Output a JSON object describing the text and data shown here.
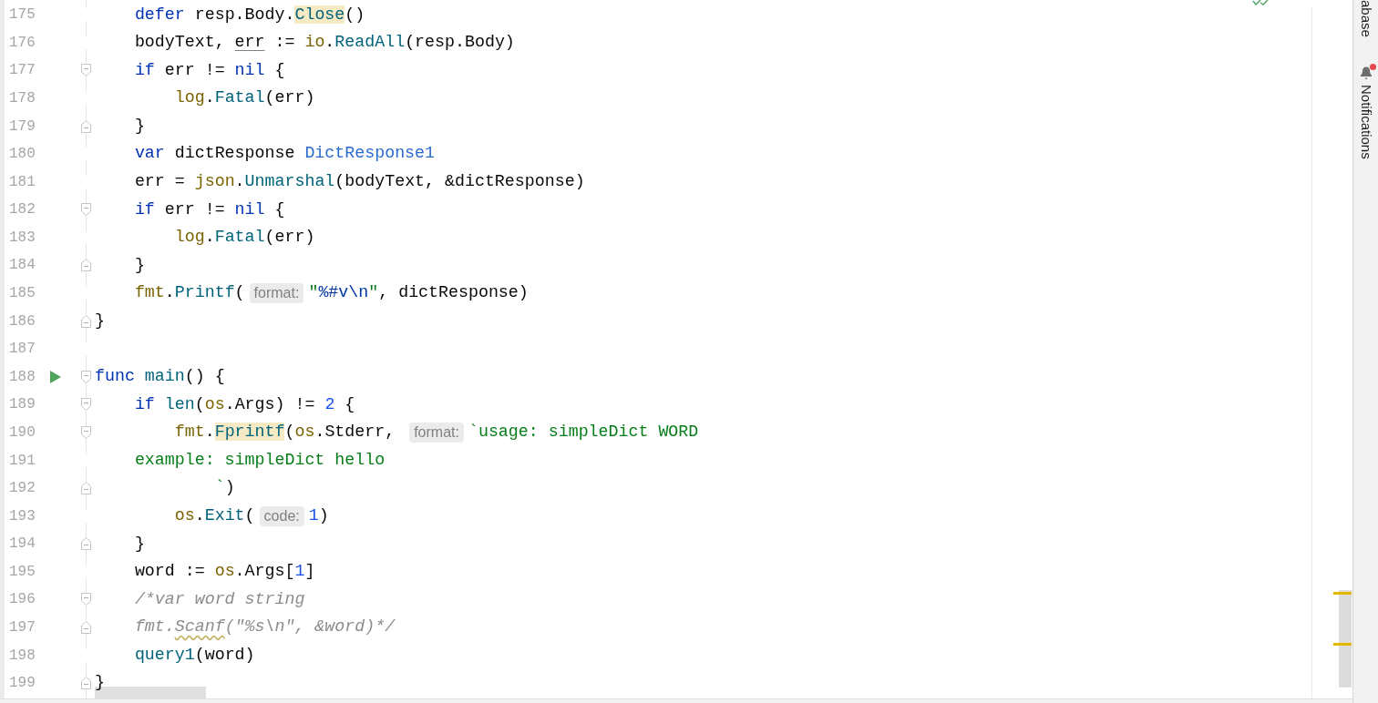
{
  "editor": {
    "lines": [
      {
        "number": "175",
        "tokens": [
          {
            "kind": "keyword",
            "text": "    defer"
          },
          {
            "kind": "plain",
            "text": " resp.Body."
          },
          {
            "kind": "function",
            "text": "Close",
            "highlighted": true
          },
          {
            "kind": "plain",
            "text": "()"
          }
        ]
      },
      {
        "number": "176",
        "tokens": [
          {
            "kind": "plain",
            "text": "    bodyText, "
          },
          {
            "kind": "plain",
            "text": "err",
            "underlined": true
          },
          {
            "kind": "plain",
            "text": " := "
          },
          {
            "kind": "package",
            "text": "io"
          },
          {
            "kind": "plain",
            "text": "."
          },
          {
            "kind": "function",
            "text": "ReadAll"
          },
          {
            "kind": "plain",
            "text": "(resp.Body)"
          }
        ]
      },
      {
        "number": "177",
        "fold_start": true,
        "tokens": [
          {
            "kind": "keyword",
            "text": "    if"
          },
          {
            "kind": "plain",
            "text": " err != "
          },
          {
            "kind": "keyword",
            "text": "nil"
          },
          {
            "kind": "plain",
            "text": " {"
          }
        ]
      },
      {
        "number": "178",
        "tokens": [
          {
            "kind": "package",
            "text": "        log"
          },
          {
            "kind": "plain",
            "text": "."
          },
          {
            "kind": "function",
            "text": "Fatal"
          },
          {
            "kind": "plain",
            "text": "(err)"
          }
        ]
      },
      {
        "number": "179",
        "fold_end": true,
        "tokens": [
          {
            "kind": "plain",
            "text": "    }"
          }
        ]
      },
      {
        "number": "180",
        "tokens": [
          {
            "kind": "keyword",
            "text": "    var"
          },
          {
            "kind": "plain",
            "text": " dictResponse "
          },
          {
            "kind": "type",
            "text": "DictResponse1"
          }
        ]
      },
      {
        "number": "181",
        "tokens": [
          {
            "kind": "plain",
            "text": "    err = "
          },
          {
            "kind": "package",
            "text": "json"
          },
          {
            "kind": "plain",
            "text": "."
          },
          {
            "kind": "function",
            "text": "Unmarshal"
          },
          {
            "kind": "plain",
            "text": "(bodyText, &dictResponse)"
          }
        ]
      },
      {
        "number": "182",
        "fold_start": true,
        "tokens": [
          {
            "kind": "keyword",
            "text": "    if"
          },
          {
            "kind": "plain",
            "text": " err != "
          },
          {
            "kind": "keyword",
            "text": "nil"
          },
          {
            "kind": "plain",
            "text": " {"
          }
        ]
      },
      {
        "number": "183",
        "tokens": [
          {
            "kind": "package",
            "text": "        log"
          },
          {
            "kind": "plain",
            "text": "."
          },
          {
            "kind": "function",
            "text": "Fatal"
          },
          {
            "kind": "plain",
            "text": "(err)"
          }
        ]
      },
      {
        "number": "184",
        "fold_end": true,
        "tokens": [
          {
            "kind": "plain",
            "text": "    }"
          }
        ]
      },
      {
        "number": "185",
        "tokens": [
          {
            "kind": "package",
            "text": "    fmt"
          },
          {
            "kind": "plain",
            "text": "."
          },
          {
            "kind": "function",
            "text": "Printf"
          },
          {
            "kind": "plain",
            "text": "("
          },
          {
            "kind": "hint",
            "text": "format:"
          },
          {
            "kind": "string",
            "text": "\""
          },
          {
            "kind": "escape",
            "text": "%#v\\n"
          },
          {
            "kind": "string",
            "text": "\""
          },
          {
            "kind": "plain",
            "text": ", dictResponse)"
          }
        ]
      },
      {
        "number": "186",
        "fold_end": true,
        "tokens": [
          {
            "kind": "plain",
            "text": "}"
          }
        ]
      },
      {
        "number": "187"
      },
      {
        "number": "188",
        "fold_start": true,
        "run": true,
        "tokens": [
          {
            "kind": "keyword",
            "text": "func"
          },
          {
            "kind": "function",
            "text": " main"
          },
          {
            "kind": "plain",
            "text": "() {"
          }
        ]
      },
      {
        "number": "189",
        "fold_start": true,
        "tokens": [
          {
            "kind": "keyword",
            "text": "    if"
          },
          {
            "kind": "function",
            "text": " len"
          },
          {
            "kind": "plain",
            "text": "("
          },
          {
            "kind": "package",
            "text": "os"
          },
          {
            "kind": "plain",
            "text": ".Args) != "
          },
          {
            "kind": "number",
            "text": "2"
          },
          {
            "kind": "plain",
            "text": " {"
          }
        ]
      },
      {
        "number": "190",
        "fold_start": true,
        "tokens": [
          {
            "kind": "package",
            "text": "        fmt"
          },
          {
            "kind": "plain",
            "text": "."
          },
          {
            "kind": "function",
            "text": "Fprintf",
            "highlighted": true
          },
          {
            "kind": "plain",
            "text": "("
          },
          {
            "kind": "package",
            "text": "os"
          },
          {
            "kind": "plain",
            "text": ".Stderr, "
          },
          {
            "kind": "hint",
            "text": "format:"
          },
          {
            "kind": "string",
            "text": "`usage: simpleDict WORD"
          }
        ]
      },
      {
        "number": "191",
        "tokens": [
          {
            "kind": "string",
            "text": "    example: simpleDict hello"
          }
        ]
      },
      {
        "number": "192",
        "fold_end": true,
        "tokens": [
          {
            "kind": "string",
            "text": "            `"
          },
          {
            "kind": "plain",
            "text": ")"
          }
        ]
      },
      {
        "number": "193",
        "tokens": [
          {
            "kind": "package",
            "text": "        os"
          },
          {
            "kind": "plain",
            "text": "."
          },
          {
            "kind": "function",
            "text": "Exit"
          },
          {
            "kind": "plain",
            "text": "("
          },
          {
            "kind": "hint",
            "text": "code:"
          },
          {
            "kind": "number",
            "text": "1"
          },
          {
            "kind": "plain",
            "text": ")"
          }
        ]
      },
      {
        "number": "194",
        "fold_end": true,
        "tokens": [
          {
            "kind": "plain",
            "text": "    }"
          }
        ]
      },
      {
        "number": "195",
        "tokens": [
          {
            "kind": "plain",
            "text": "    word := "
          },
          {
            "kind": "package",
            "text": "os"
          },
          {
            "kind": "plain",
            "text": ".Args["
          },
          {
            "kind": "number",
            "text": "1"
          },
          {
            "kind": "plain",
            "text": "]"
          }
        ]
      },
      {
        "number": "196",
        "fold_start": true,
        "tokens": [
          {
            "kind": "comment",
            "text": "    /*var word string"
          }
        ]
      },
      {
        "number": "197",
        "fold_end": true,
        "tokens": [
          {
            "kind": "comment",
            "text": "    fmt."
          },
          {
            "kind": "comment",
            "text": "Scanf",
            "misspelled": true
          },
          {
            "kind": "comment",
            "text": "(\"%s\\n\", &word)*/"
          }
        ]
      },
      {
        "number": "198",
        "tokens": [
          {
            "kind": "function",
            "text": "    query1"
          },
          {
            "kind": "plain",
            "text": "(word)"
          }
        ]
      },
      {
        "number": "199",
        "fold_end": true,
        "tokens": [
          {
            "kind": "plain",
            "text": "}"
          }
        ]
      }
    ]
  },
  "tool_windows": [
    {
      "kind": "text",
      "label": "abase"
    },
    {
      "kind": "bell",
      "label": "Notifications",
      "has_notification": true
    }
  ]
}
